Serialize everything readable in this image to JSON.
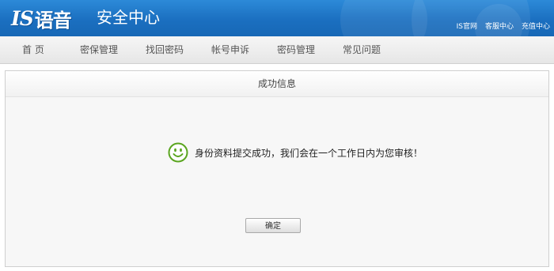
{
  "header": {
    "logo_mark": "IS",
    "logo_name": "语音",
    "subtitle": "安全中心",
    "links": [
      "IS官网",
      "客服中心",
      "充值中心"
    ]
  },
  "nav": {
    "items": [
      "首 页",
      "密保管理",
      "找回密码",
      "帐号申诉",
      "密码管理",
      "常见问题"
    ]
  },
  "panel": {
    "title": "成功信息",
    "message": "身份资料提交成功，我们会在一个工作日内为您审核！",
    "confirm_label": "确定",
    "icon": "smile-icon"
  },
  "colors": {
    "header_blue": "#1b6fc0",
    "smile_green": "#5aa51f"
  }
}
